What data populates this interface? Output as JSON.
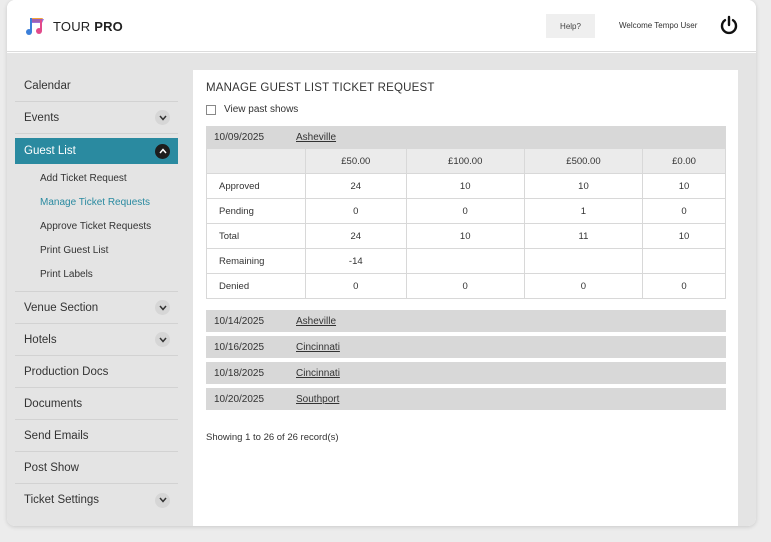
{
  "brand": {
    "name_light": "TOUR",
    "name_bold": "PRO"
  },
  "header": {
    "help_label": "Help?",
    "welcome_text": "Welcome Tempo User"
  },
  "sidebar": {
    "items": [
      {
        "label": "Calendar",
        "chevron": false
      },
      {
        "label": "Events",
        "chevron": true
      },
      {
        "label": "Guest List",
        "chevron": true,
        "active": true
      },
      {
        "label": "Venue Section",
        "chevron": true
      },
      {
        "label": "Hotels",
        "chevron": true
      },
      {
        "label": "Production Docs",
        "chevron": false
      },
      {
        "label": "Documents",
        "chevron": false
      },
      {
        "label": "Send Emails",
        "chevron": false
      },
      {
        "label": "Post Show",
        "chevron": false
      },
      {
        "label": "Ticket Settings",
        "chevron": true
      }
    ],
    "guest_list_sub": [
      "Add Ticket Request",
      "Manage Ticket Requests",
      "Approve Ticket Requests",
      "Print Guest List",
      "Print Labels"
    ]
  },
  "main": {
    "title": "MANAGE GUEST LIST TICKET REQUEST",
    "view_past_label": "View past shows",
    "shows": [
      {
        "date": "10/09/2025",
        "city": "Asheville",
        "expanded": true
      },
      {
        "date": "10/14/2025",
        "city": "Asheville"
      },
      {
        "date": "10/16/2025",
        "city": "Cincinnati"
      },
      {
        "date": "10/18/2025",
        "city": "Cincinnati"
      },
      {
        "date": "10/20/2025",
        "city": "Southport"
      }
    ],
    "price_headers": [
      "£50.00",
      "£100.00",
      "£500.00",
      "£0.00"
    ],
    "rows": [
      {
        "label": "Approved",
        "values": [
          "24",
          "10",
          "10",
          "10"
        ]
      },
      {
        "label": "Pending",
        "values": [
          "0",
          "0",
          "1",
          "0"
        ]
      },
      {
        "label": "Total",
        "values": [
          "24",
          "10",
          "11",
          "10"
        ]
      },
      {
        "label": "Remaining",
        "values": [
          "-14",
          "",
          "",
          ""
        ]
      },
      {
        "label": "Denied",
        "values": [
          "0",
          "0",
          "0",
          "0"
        ]
      }
    ],
    "showing_text": "Showing 1 to 26 of 26 record(s)"
  },
  "colors": {
    "accent": "#2a8aa0",
    "table_header": "#d8d8d8"
  },
  "icons": {
    "logo": "music-flag-icon",
    "power": "power-icon",
    "chevron": "chevron-down-icon",
    "chevron_up": "chevron-up-icon"
  }
}
